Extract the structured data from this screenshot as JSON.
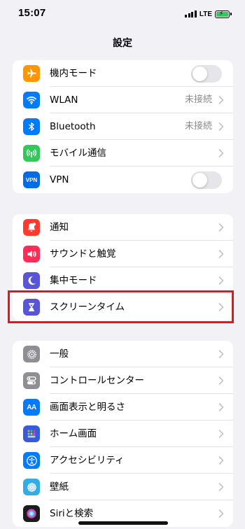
{
  "status_bar": {
    "time": "15:07",
    "network": "LTE",
    "battery_color": "#34c759"
  },
  "nav": {
    "title": "設定"
  },
  "groups": [
    {
      "items": [
        {
          "label": "機内モード",
          "icon": "airplane-icon",
          "color": "#ff9500",
          "accessory": "toggle",
          "toggle_on": false
        },
        {
          "label": "WLAN",
          "icon": "wifi-icon",
          "color": "#007aff",
          "accessory": "chevron",
          "value": "未接続"
        },
        {
          "label": "Bluetooth",
          "icon": "bluetooth-icon",
          "color": "#007aff",
          "accessory": "chevron",
          "value": "未接続"
        },
        {
          "label": "モバイル通信",
          "icon": "cellular-icon",
          "color": "#34c759",
          "accessory": "chevron"
        },
        {
          "label": "VPN",
          "icon": "vpn-icon",
          "color": "#006be6",
          "accessory": "toggle",
          "toggle_on": false,
          "icon_text": "VPN"
        }
      ]
    },
    {
      "items": [
        {
          "label": "通知",
          "icon": "notifications-icon",
          "color": "#ff3b30",
          "accessory": "chevron"
        },
        {
          "label": "サウンドと触覚",
          "icon": "sound-icon",
          "color": "#ff2d55",
          "accessory": "chevron"
        },
        {
          "label": "集中モード",
          "icon": "moon-icon",
          "color": "#5856d6",
          "accessory": "chevron"
        },
        {
          "label": "スクリーンタイム",
          "icon": "hourglass-icon",
          "color": "#5856d6",
          "accessory": "chevron",
          "highlighted": true
        }
      ]
    },
    {
      "items": [
        {
          "label": "一般",
          "icon": "gear-icon",
          "color": "#8e8e93",
          "accessory": "chevron"
        },
        {
          "label": "コントロールセンター",
          "icon": "switches-icon",
          "color": "#8e8e93",
          "accessory": "chevron"
        },
        {
          "label": "画面表示と明るさ",
          "icon": "display-icon",
          "color": "#007aff",
          "accessory": "chevron",
          "icon_text": "AA"
        },
        {
          "label": "ホーム画面",
          "icon": "home-screen-icon",
          "color": "#3a5bd9",
          "accessory": "chevron"
        },
        {
          "label": "アクセシビリティ",
          "icon": "accessibility-icon",
          "color": "#007aff",
          "accessory": "chevron"
        },
        {
          "label": "壁紙",
          "icon": "wallpaper-icon",
          "color": "#32ade6",
          "accessory": "chevron"
        },
        {
          "label": "Siriと検索",
          "icon": "siri-icon",
          "color": "#1c1c1e",
          "accessory": "chevron"
        }
      ]
    }
  ],
  "highlight_color": "#e8141b"
}
